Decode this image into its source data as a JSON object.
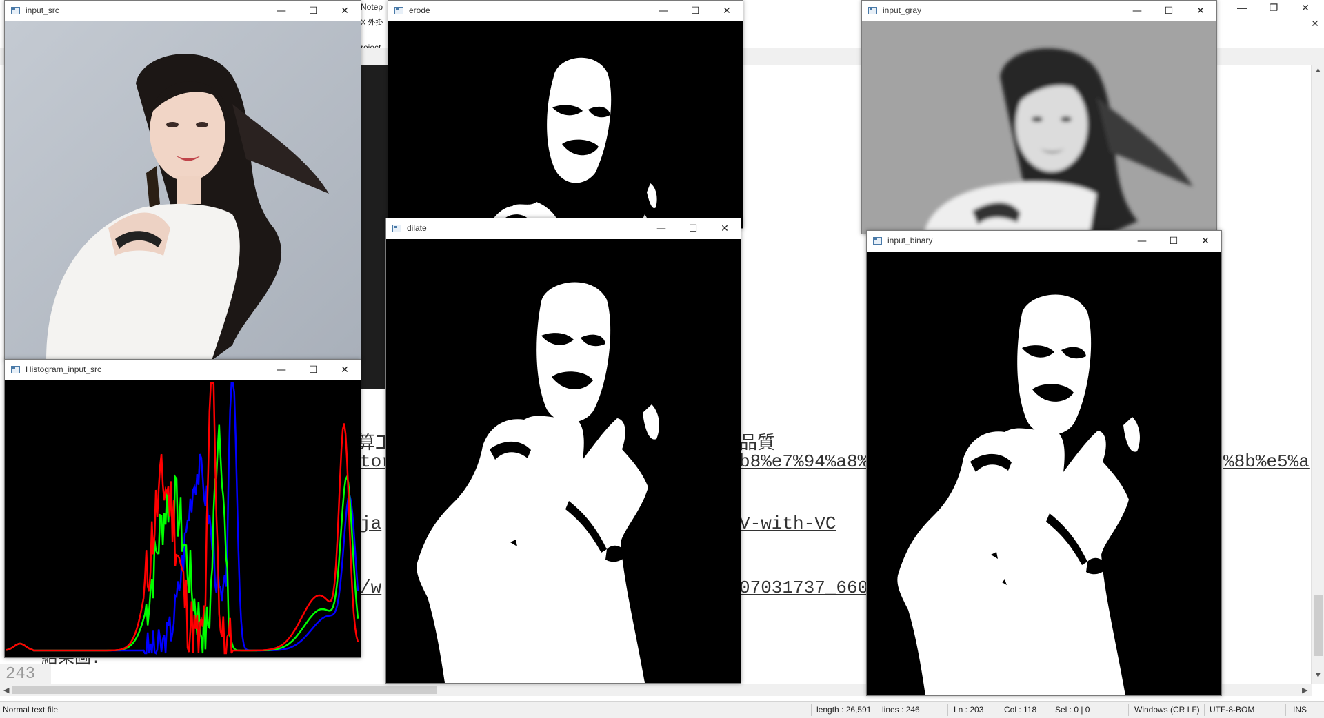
{
  "editor": {
    "caption": "Notep",
    "menu_fragment": "X  外掛",
    "tab_fragment": "roject_",
    "window_controls": {
      "minimize": "—",
      "restore": "❐",
      "close": "✕"
    },
    "lines": [
      {
        "text": "算工",
        "style": "plain"
      },
      {
        "text": "tor",
        "style": "link"
      },
      {
        "text": "ja",
        "style": "link"
      },
      {
        "text": "/w",
        "style": "link"
      },
      {
        "text": "品質",
        "style": "plain"
      },
      {
        "text": "b8%e7%94%a8%",
        "style": "link"
      },
      {
        "text": "V-with-VC",
        "style": "link"
      },
      {
        "text": "07031737_660",
        "style": "link"
      },
      {
        "text": "%8b%e5%a",
        "style": "link"
      }
    ],
    "partial_line": "結果圖:",
    "line_number": "243"
  },
  "statusbar": {
    "file_type": "Normal text file",
    "length": "length : 26,591",
    "lines": "lines : 246",
    "ln": "Ln : 203",
    "col": "Col : 118",
    "sel": "Sel : 0 | 0",
    "eol": "Windows (CR LF)",
    "encoding": "UTF-8-BOM",
    "mode": "INS"
  },
  "windows": {
    "input_src": {
      "title": "input_src"
    },
    "erode": {
      "title": "erode"
    },
    "input_gray": {
      "title": "input_gray"
    },
    "histogram": {
      "title": "Histogram_input_src"
    },
    "dilate": {
      "title": "dilate"
    },
    "input_binary": {
      "title": "input_binary"
    }
  },
  "window_buttons": {
    "minimize": "—",
    "maximize": "☐",
    "close": "✕"
  },
  "colors": {
    "hist_red": "#ff0000",
    "hist_green": "#00ff00",
    "hist_blue": "#0000ff",
    "photo_background": "#b3bac4",
    "gray_background": "#9a9a9a"
  }
}
